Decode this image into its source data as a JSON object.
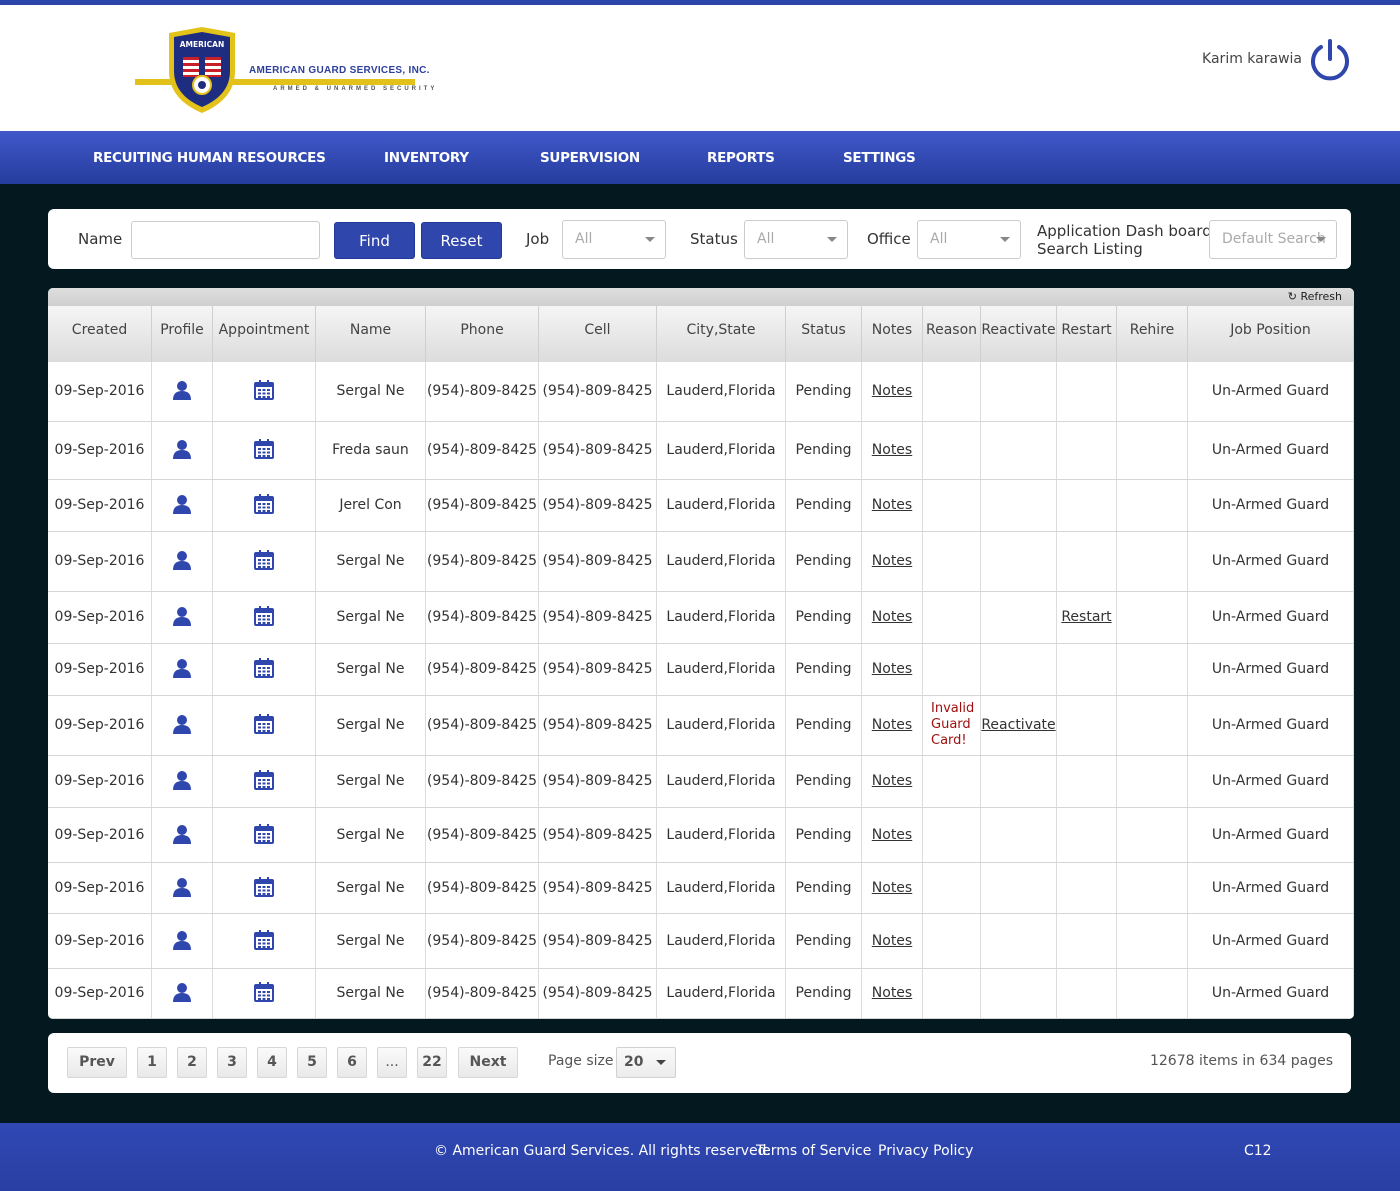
{
  "brand": {
    "shield_text": "AMERICAN",
    "company": "AMERICAN GUARD SERVICES, INC.",
    "tagline": "ARMED & UNARMED SECURITY",
    "colors": {
      "primary": "#2f46ad",
      "accent": "#e2c21a",
      "background": "#041820"
    }
  },
  "user": {
    "name": "Karim karawia",
    "icon": "power-icon"
  },
  "nav": {
    "items": [
      {
        "label": "RECUITING HUMAN RESOURCES"
      },
      {
        "label": "INVENTORY"
      },
      {
        "label": "SUPERVISION"
      },
      {
        "label": "REPORTS"
      },
      {
        "label": "SETTINGS"
      }
    ]
  },
  "filters": {
    "name_label": "Name",
    "name_value": "",
    "find_label": "Find",
    "reset_label": "Reset",
    "job_label": "Job",
    "job_value": "All",
    "status_label": "Status",
    "status_value": "All",
    "office_label": "Office",
    "office_value": "All",
    "dashboard_label_line1": "Application Dash board",
    "dashboard_label_line2": "Search Listing",
    "dashboard_value": "Default Search"
  },
  "grid": {
    "refresh_label": "Refresh",
    "columns": [
      "Created",
      "Profile",
      "Appointment",
      "Name",
      "Phone",
      "Cell",
      "City,State",
      "Status",
      "Notes",
      "Reason",
      "Reactivate",
      "Restart",
      "Rehire",
      "Job Position"
    ],
    "rows": [
      {
        "created": "09-Sep-2016",
        "name": "Sergal Ne",
        "phone": "(954)-809-8425",
        "cell": "(954)-809-8425",
        "city": "Lauderd,Florida",
        "status": "Pending",
        "notes": "Notes",
        "reason": "",
        "reactivate": "",
        "restart": "",
        "rehire": "",
        "job": "Un-Armed Guard"
      },
      {
        "created": "09-Sep-2016",
        "name": "Freda saun",
        "phone": "(954)-809-8425",
        "cell": "(954)-809-8425",
        "city": "Lauderd,Florida",
        "status": "Pending",
        "notes": "Notes",
        "reason": "",
        "reactivate": "",
        "restart": "",
        "rehire": "",
        "job": "Un-Armed Guard"
      },
      {
        "created": "09-Sep-2016",
        "name": "Jerel Con",
        "phone": "(954)-809-8425",
        "cell": "(954)-809-8425",
        "city": "Lauderd,Florida",
        "status": "Pending",
        "notes": "Notes",
        "reason": "",
        "reactivate": "",
        "restart": "",
        "rehire": "",
        "job": "Un-Armed Guard"
      },
      {
        "created": "09-Sep-2016",
        "name": "Sergal Ne",
        "phone": "(954)-809-8425",
        "cell": "(954)-809-8425",
        "city": "Lauderd,Florida",
        "status": "Pending",
        "notes": "Notes",
        "reason": "",
        "reactivate": "",
        "restart": "",
        "rehire": "",
        "job": "Un-Armed Guard"
      },
      {
        "created": "09-Sep-2016",
        "name": "Sergal Ne",
        "phone": "(954)-809-8425",
        "cell": "(954)-809-8425",
        "city": "Lauderd,Florida",
        "status": "Pending",
        "notes": "Notes",
        "reason": "",
        "reactivate": "",
        "restart": "Restart",
        "rehire": "",
        "job": "Un-Armed Guard"
      },
      {
        "created": "09-Sep-2016",
        "name": "Sergal Ne",
        "phone": "(954)-809-8425",
        "cell": "(954)-809-8425",
        "city": "Lauderd,Florida",
        "status": "Pending",
        "notes": "Notes",
        "reason": "",
        "reactivate": "",
        "restart": "",
        "rehire": "",
        "job": "Un-Armed Guard"
      },
      {
        "created": "09-Sep-2016",
        "name": "Sergal Ne",
        "phone": "(954)-809-8425",
        "cell": "(954)-809-8425",
        "city": "Lauderd,Florida",
        "status": "Pending",
        "notes": "Notes",
        "reason": "Invalid Guard Card!",
        "reactivate": "Reactivate",
        "restart": "",
        "rehire": "",
        "job": "Un-Armed Guard"
      },
      {
        "created": "09-Sep-2016",
        "name": "Sergal Ne",
        "phone": "(954)-809-8425",
        "cell": "(954)-809-8425",
        "city": "Lauderd,Florida",
        "status": "Pending",
        "notes": "Notes",
        "reason": "",
        "reactivate": "",
        "restart": "",
        "rehire": "",
        "job": "Un-Armed Guard"
      },
      {
        "created": "09-Sep-2016",
        "name": "Sergal Ne",
        "phone": "(954)-809-8425",
        "cell": "(954)-809-8425",
        "city": "Lauderd,Florida",
        "status": "Pending",
        "notes": "Notes",
        "reason": "",
        "reactivate": "",
        "restart": "",
        "rehire": "",
        "job": "Un-Armed Guard"
      },
      {
        "created": "09-Sep-2016",
        "name": "Sergal Ne",
        "phone": "(954)-809-8425",
        "cell": "(954)-809-8425",
        "city": "Lauderd,Florida",
        "status": "Pending",
        "notes": "Notes",
        "reason": "",
        "reactivate": "",
        "restart": "",
        "rehire": "",
        "job": "Un-Armed Guard"
      },
      {
        "created": "09-Sep-2016",
        "name": "Sergal Ne",
        "phone": "(954)-809-8425",
        "cell": "(954)-809-8425",
        "city": "Lauderd,Florida",
        "status": "Pending",
        "notes": "Notes",
        "reason": "",
        "reactivate": "",
        "restart": "",
        "rehire": "",
        "job": "Un-Armed Guard"
      },
      {
        "created": "09-Sep-2016",
        "name": "Sergal Ne",
        "phone": "(954)-809-8425",
        "cell": "(954)-809-8425",
        "city": "Lauderd,Florida",
        "status": "Pending",
        "notes": "Notes",
        "reason": "",
        "reactivate": "",
        "restart": "",
        "rehire": "",
        "job": "Un-Armed Guard"
      }
    ]
  },
  "pager": {
    "prev": "Prev",
    "pages": [
      "1",
      "2",
      "3",
      "4",
      "5",
      "6",
      "...",
      "22"
    ],
    "next": "Next",
    "page_size_label": "Page size",
    "page_size": "20",
    "info": "12678 items in 634 pages"
  },
  "footer": {
    "copyright": "© American Guard Services. All rights reserved.",
    "terms": "Terms of Service",
    "privacy": "Privacy Policy",
    "code": "C12"
  }
}
